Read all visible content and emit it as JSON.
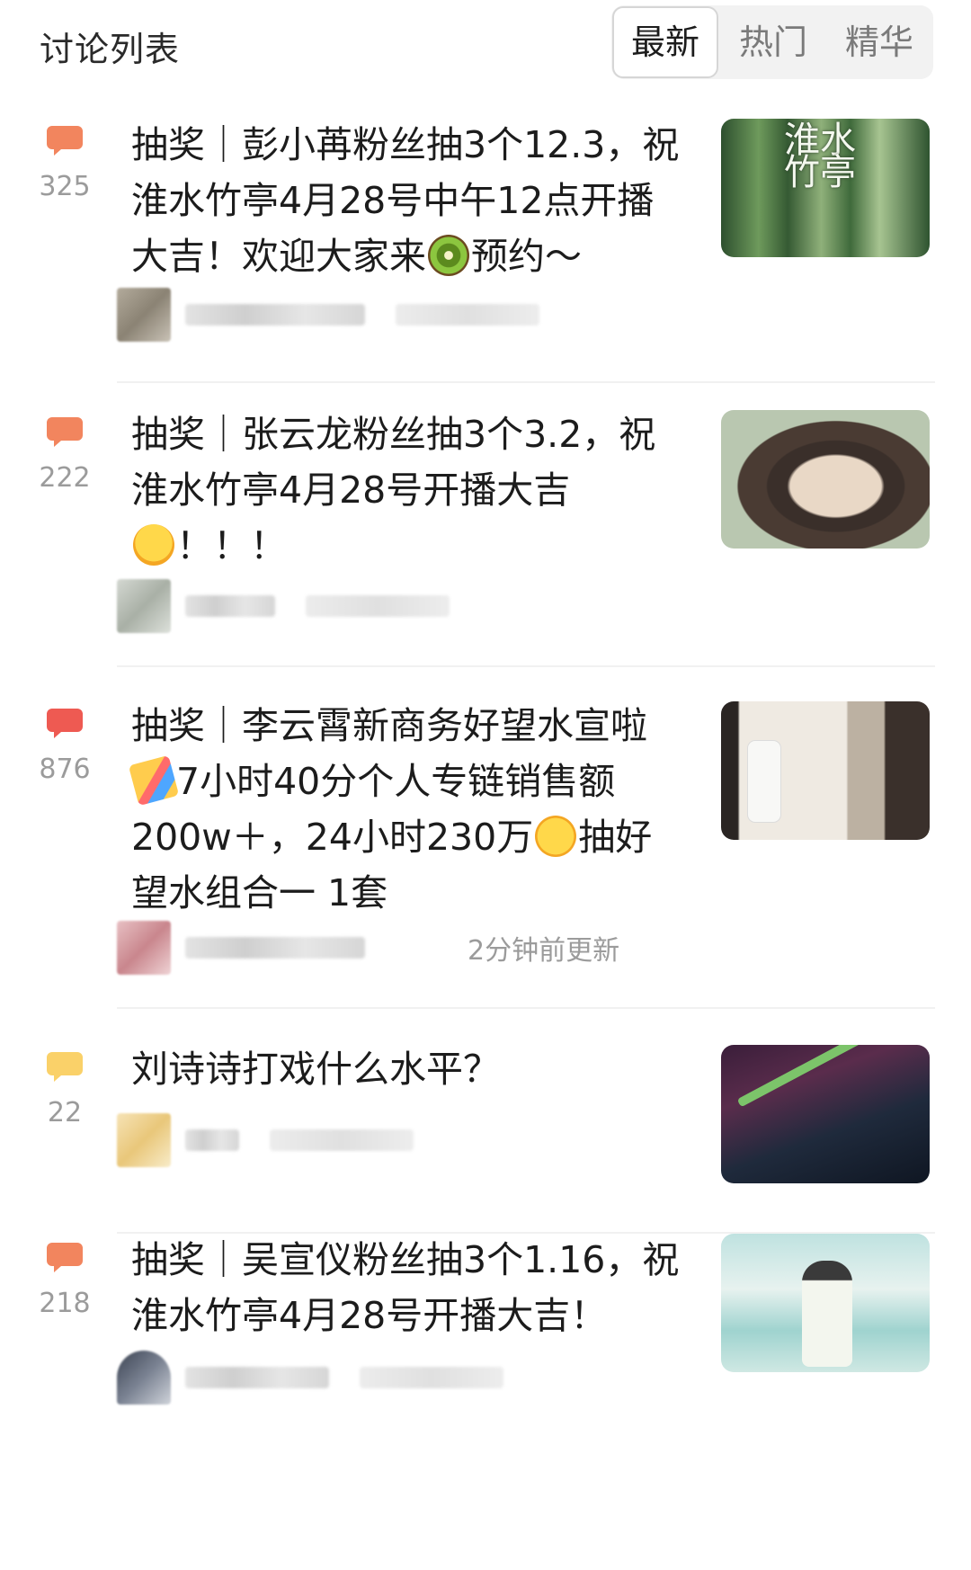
{
  "header": {
    "title": "讨论列表",
    "tabs": [
      {
        "label": "最新",
        "active": true
      },
      {
        "label": "热门",
        "active": false
      },
      {
        "label": "精华",
        "active": false
      }
    ]
  },
  "colors": {
    "bubble_orange": "#f2855e",
    "bubble_red": "#ee5a52",
    "bubble_yellow": "#fad169",
    "count_gray": "#9b9b9b"
  },
  "posts": [
    {
      "comment_count": "325",
      "bubble_icon": "orange-chat-bubble-icon",
      "title_parts": [
        "抽奖｜彭小苒粉丝抽3个12.3，祝淮水竹亭4月28号中午12点开播大吉！欢迎大家来",
        "预约～"
      ],
      "emoji": [
        "kiwi-emoji-icon"
      ],
      "meta_text": "",
      "thumbnail": "bamboo-forest-poster",
      "thumbnail_text": "淮水竹亭"
    },
    {
      "comment_count": "222",
      "bubble_icon": "orange-chat-bubble-icon",
      "title_parts": [
        "抽奖｜张云龙粉丝抽3个3.2，祝淮水竹亭4月28号开播大吉",
        "！！！"
      ],
      "emoji": [
        "smiling-face-with-hearts-emoji-icon"
      ],
      "meta_text": "",
      "thumbnail": "actor-portrait"
    },
    {
      "comment_count": "876",
      "bubble_icon": "red-chat-bubble-icon",
      "title_parts": [
        "抽奖｜李云霄新商务好望水宣啦",
        "7小时40分个人专链销售额200w＋，24小时230万",
        "抽好望水组合一 1套"
      ],
      "emoji": [
        "party-popper-emoji-icon",
        "partying-face-emoji-icon"
      ],
      "meta_text": "2分钟前更新",
      "thumbnail": "actress-with-bottle"
    },
    {
      "comment_count": "22",
      "bubble_icon": "yellow-chat-bubble-icon",
      "title_parts": [
        "刘诗诗打戏什么水平？"
      ],
      "emoji": [],
      "meta_text": "",
      "thumbnail": "sword-fight-still"
    },
    {
      "comment_count": "218",
      "bubble_icon": "orange-chat-bubble-icon",
      "title_parts": [
        "抽奖｜吴宣仪粉丝抽3个1.16，祝淮水竹亭4月28号开播大吉！"
      ],
      "emoji": [],
      "meta_text": "",
      "thumbnail": "ink-painting-poster"
    }
  ]
}
